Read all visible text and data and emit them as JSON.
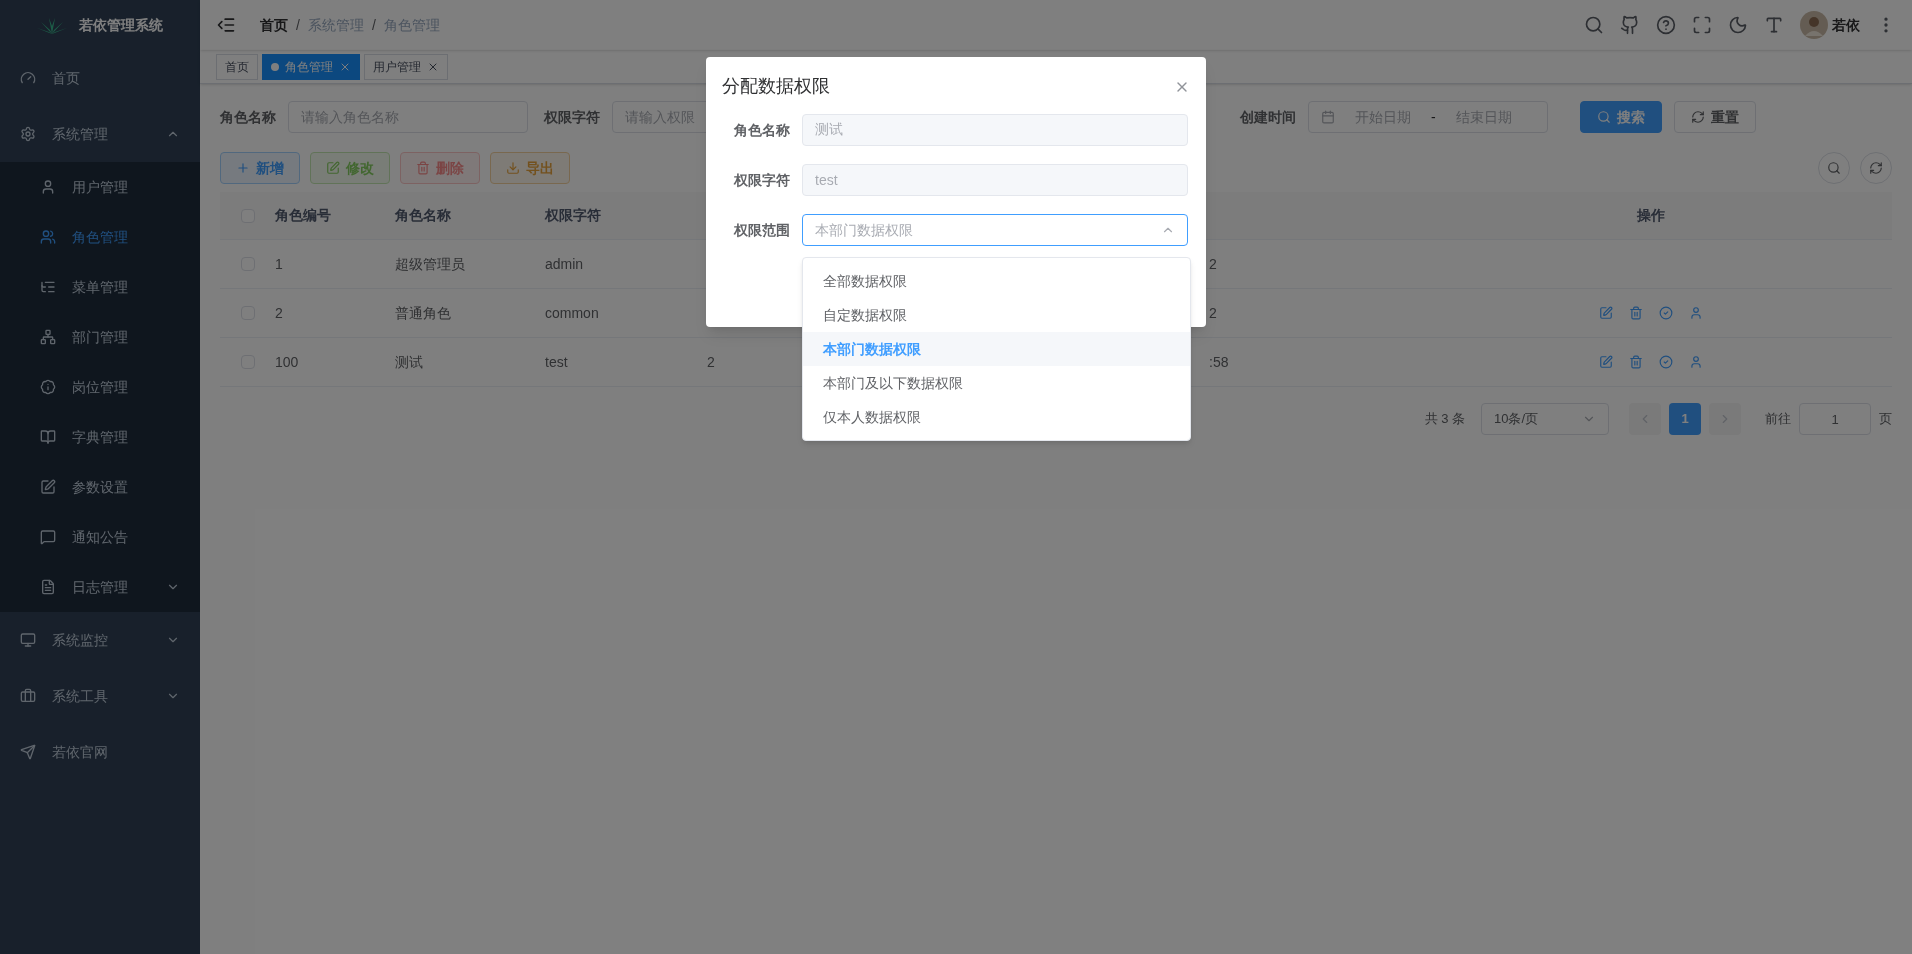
{
  "app_title": "若依管理系统",
  "breadcrumb_separator": "/",
  "breadcrumb": [
    {
      "label": "首页",
      "current": false
    },
    {
      "label": "系统管理",
      "current": true
    },
    {
      "label": "角色管理",
      "current": true
    }
  ],
  "user": {
    "name": "若依"
  },
  "tabs": [
    {
      "label": "首页",
      "selected": false,
      "closable": false
    },
    {
      "label": "角色管理",
      "selected": true,
      "closable": true
    },
    {
      "label": "用户管理",
      "selected": false,
      "closable": true
    }
  ],
  "sidebar": {
    "items": [
      {
        "label": "首页",
        "selected": false
      },
      {
        "label": "系统管理",
        "selected": false,
        "expanded": true,
        "children": [
          {
            "label": "用户管理",
            "selected": false
          },
          {
            "label": "角色管理",
            "selected": true
          },
          {
            "label": "菜单管理",
            "selected": false
          },
          {
            "label": "部门管理",
            "selected": false
          },
          {
            "label": "岗位管理",
            "selected": false
          },
          {
            "label": "字典管理",
            "selected": false
          },
          {
            "label": "参数设置",
            "selected": false
          },
          {
            "label": "通知公告",
            "selected": false
          },
          {
            "label": "日志管理",
            "selected": false,
            "expanded": false
          }
        ]
      },
      {
        "label": "系统监控",
        "selected": false,
        "expanded": false
      },
      {
        "label": "系统工具",
        "selected": false,
        "expanded": false
      },
      {
        "label": "若依官网",
        "selected": false
      }
    ]
  },
  "query": {
    "fields": [
      {
        "label": "角色名称",
        "placeholder": "请输入角色名称"
      },
      {
        "label": "权限字符",
        "placeholder": "请输入权限"
      }
    ],
    "date_range": {
      "label": "创建时间",
      "start_placeholder": "开始日期",
      "separator": "-",
      "end_placeholder": "结束日期"
    },
    "buttons": [
      {
        "label": "搜索",
        "kind": "primary"
      },
      {
        "label": "重置",
        "kind": "plain"
      }
    ]
  },
  "toolbar": [
    {
      "label": "新增",
      "kind": "primary",
      "disabled": false
    },
    {
      "label": "修改",
      "kind": "success",
      "disabled": true
    },
    {
      "label": "删除",
      "kind": "danger",
      "disabled": true
    },
    {
      "label": "导出",
      "kind": "warning",
      "disabled": false
    }
  ],
  "table": {
    "header_checked": false,
    "columns": [
      "角色编号",
      "角色名称",
      "权限字符",
      "操作"
    ],
    "rows": [
      {
        "checked": false,
        "id": "1",
        "name": "超级管理员",
        "key": "admin",
        "time_tail": "2",
        "actions": false
      },
      {
        "checked": false,
        "id": "2",
        "name": "普通角色",
        "key": "common",
        "time_tail": "2",
        "actions": true
      },
      {
        "checked": false,
        "id": "100",
        "name": "测试",
        "key": "test",
        "sort": "2",
        "time_tail": ":58",
        "actions": true
      }
    ]
  },
  "pagination": {
    "total": "共 3 条",
    "page_size": "10条/页",
    "pages": [
      {
        "label": "1",
        "selected": true
      }
    ],
    "goto_label": "前往",
    "goto_value": "1",
    "goto_suffix": "页"
  },
  "dialog": {
    "title": "分配数据权限",
    "fields": [
      {
        "label": "角色名称",
        "kind": "text",
        "value": "测试",
        "disabled": true
      },
      {
        "label": "权限字符",
        "kind": "text",
        "value": "test",
        "disabled": true
      },
      {
        "label": "权限范围",
        "kind": "select",
        "value": "本部门数据权限",
        "expanded": true
      }
    ],
    "options": [
      {
        "label": "全部数据权限",
        "selected": false
      },
      {
        "label": "自定数据权限",
        "selected": false
      },
      {
        "label": "本部门数据权限",
        "selected": true
      },
      {
        "label": "本部门及以下数据权限",
        "selected": false
      },
      {
        "label": "仅本人数据权限",
        "selected": false
      }
    ]
  }
}
